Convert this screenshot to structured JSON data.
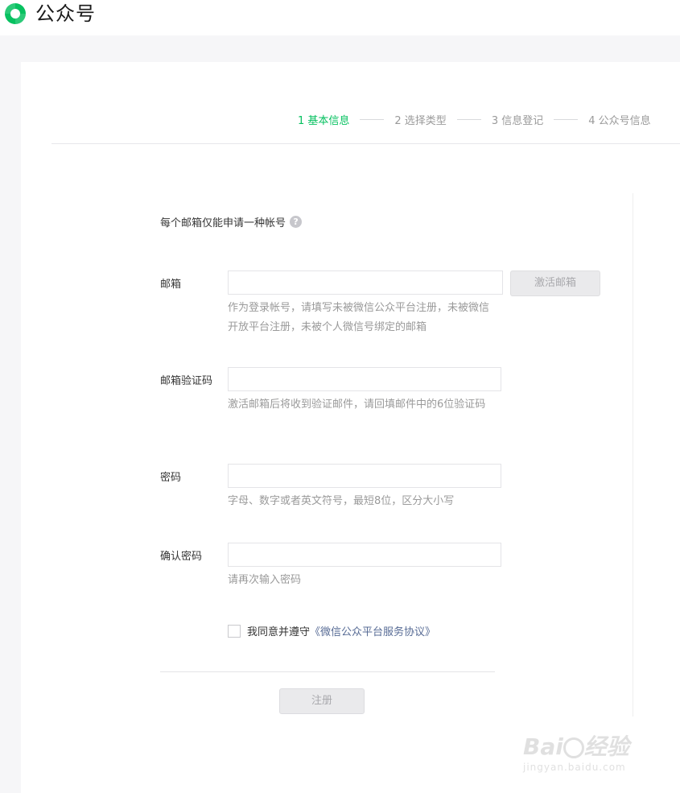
{
  "header": {
    "brand": "公众号"
  },
  "steps": [
    {
      "label": "1 基本信息",
      "active": true
    },
    {
      "label": "2 选择类型",
      "active": false
    },
    {
      "label": "3 信息登记",
      "active": false
    },
    {
      "label": "4 公众号信息",
      "active": false
    }
  ],
  "form": {
    "notice": "每个邮箱仅能申请一种帐号",
    "help_icon": "?",
    "email": {
      "label": "邮箱",
      "value": "",
      "activate_button": "激活邮箱",
      "hint": "作为登录帐号，请填写未被微信公众平台注册，未被微信开放平台注册，未被个人微信号绑定的邮箱"
    },
    "email_code": {
      "label": "邮箱验证码",
      "value": "",
      "hint": "激活邮箱后将收到验证邮件，请回填邮件中的6位验证码"
    },
    "password": {
      "label": "密码",
      "value": "",
      "hint": "字母、数字或者英文符号，最短8位，区分大小写"
    },
    "confirm_password": {
      "label": "确认密码",
      "value": "",
      "hint": "请再次输入密码"
    },
    "agreement": {
      "checked": false,
      "prefix": "我同意并遵守",
      "link": "《微信公众平台服务协议》"
    },
    "register_button": "注册"
  },
  "watermark": {
    "brand_left": "Bai",
    "brand_right": "经验",
    "url": "jingyan.baidu.com"
  },
  "colors": {
    "accent": "#07c160",
    "link": "#576b95",
    "hint": "#9a9a9a"
  }
}
